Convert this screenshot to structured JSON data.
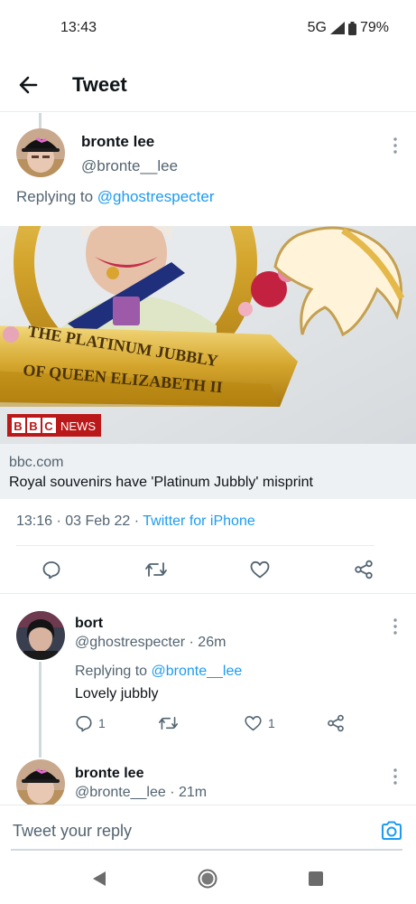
{
  "status_bar": {
    "time": "13:43",
    "network": "5G",
    "battery": "79%"
  },
  "header": {
    "title": "Tweet"
  },
  "main_tweet": {
    "author_name": "bronte lee",
    "author_handle": "@bronte__lee",
    "replying_prefix": "Replying to",
    "replying_to": "@ghostrespecter",
    "card": {
      "image_text_line1": "THE PLATINUM JUBBLY",
      "image_text_line2": "OF QUEEN ELIZABETH II",
      "badge_bbc": "BBC",
      "badge_news": "NEWS",
      "domain": "bbc.com",
      "title": "Royal souvenirs have 'Platinum Jubbly' misprint"
    },
    "timestamp": "13:16 · 03 Feb 22 · ",
    "source": "Twitter for iPhone"
  },
  "replies": [
    {
      "author_name": "bort",
      "author_handle": "@ghostrespecter · 26m",
      "replying_prefix": "Replying to",
      "replying_to": "@bronte__lee",
      "text": "Lovely jubbly",
      "reply_count": "1",
      "retweet_count": "",
      "like_count": "1"
    },
    {
      "author_name": "bronte lee",
      "author_handle": "@bronte__lee · 21m"
    }
  ],
  "compose": {
    "placeholder": "Tweet your reply"
  },
  "icons": {
    "back": "arrow-left-icon",
    "more": "more-vertical-icon",
    "reply": "speech-bubble-icon",
    "retweet": "retweet-icon",
    "like": "heart-icon",
    "share": "share-icon",
    "camera": "camera-icon"
  },
  "colors": {
    "accent": "#1d9bf0",
    "secondary_text": "#536471",
    "bbc_red": "#bb1919"
  }
}
